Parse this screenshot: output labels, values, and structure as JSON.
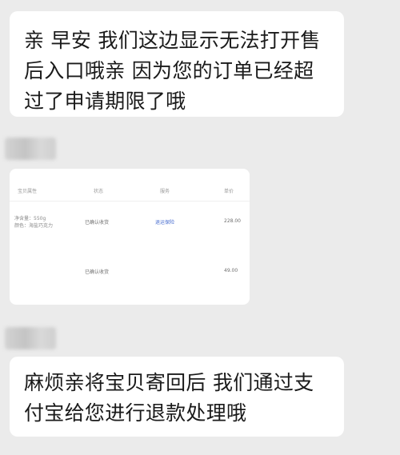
{
  "messages": [
    {
      "lines": [
        "亲 早安 我们这边显示无法打开售",
        "后入口哦亲 因为您的订单已经超",
        "过了申请期限了哦"
      ]
    },
    {
      "lines": [
        "麻烦亲将宝贝寄回后 我们通过支",
        "付宝给您进行退款处理哦"
      ]
    }
  ],
  "order_card": {
    "headers": {
      "product": "宝贝属性",
      "status": "状态",
      "service": "服务",
      "price": "单价"
    },
    "rows": [
      {
        "product_line1": "净含量：550g",
        "product_line2": "颜色：海盐巧克力",
        "status": "已确认收货",
        "service": "退运保险",
        "price": "228.00"
      },
      {
        "status": "已确认收货",
        "price": "49.00"
      }
    ]
  },
  "colors": {
    "background": "#ebebeb",
    "bubble": "#ffffff",
    "link": "#4a6fd0"
  }
}
